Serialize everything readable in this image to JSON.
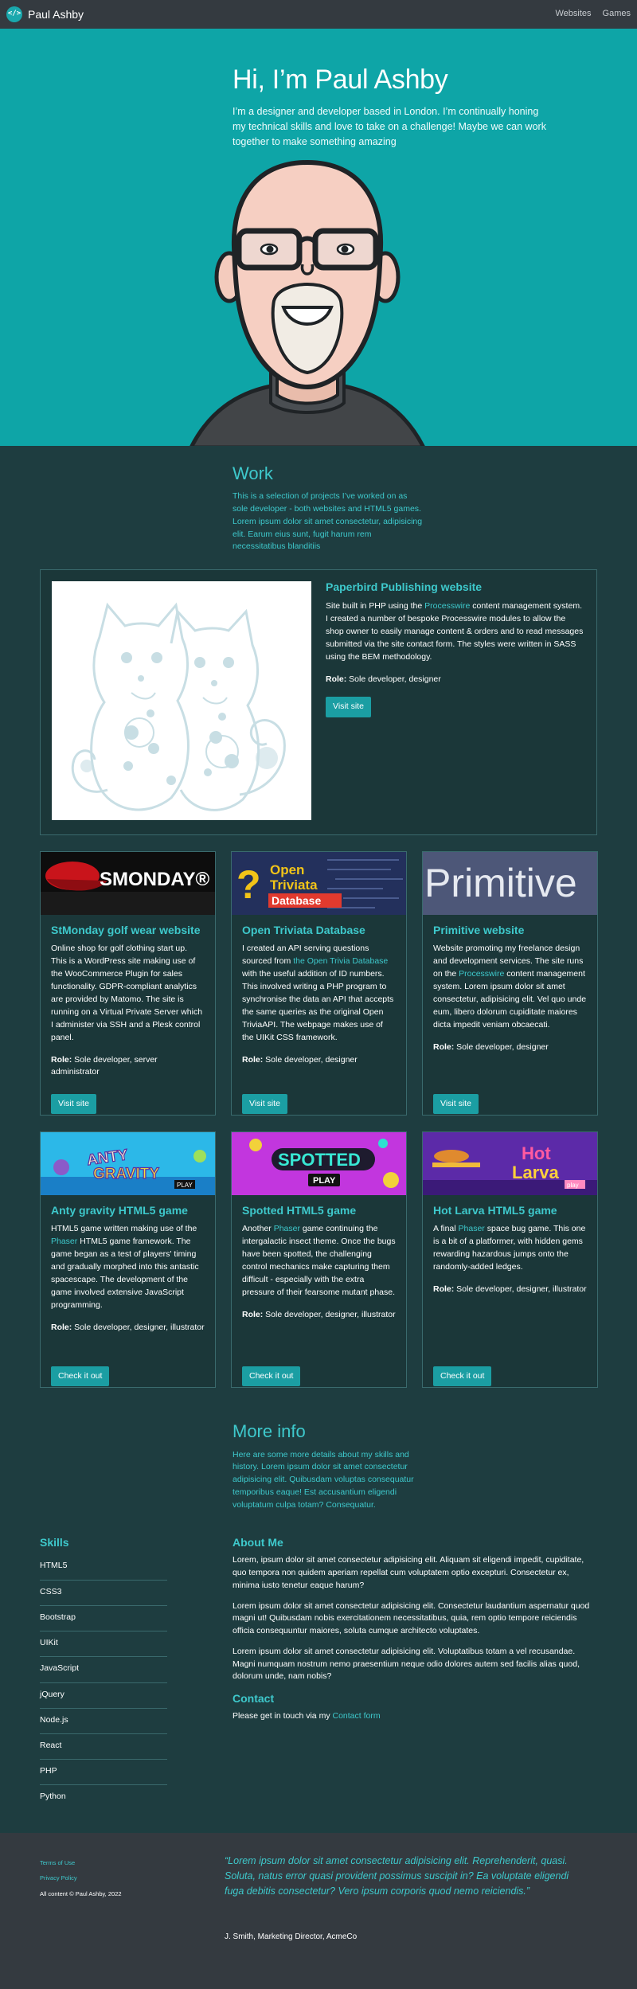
{
  "nav": {
    "brand_icon": "</>",
    "brand_name": "Paul Ashby",
    "links": [
      "Websites",
      "Games"
    ]
  },
  "hero": {
    "title": "Hi, I’m Paul Ashby",
    "subtitle": "I’m a designer and developer based in London. I’m continually honing my technical skills and love to take on a challenge! Maybe we can work together to make something amazing"
  },
  "work": {
    "heading": "Work",
    "intro": "This is a selection of projects I’ve worked on as sole developer - both websites and HTML5 games. Lorem ipsum dolor sit amet consectetur, adipisicing elit. Earum eius sunt, fugit harum rem necessitatibus blanditiis",
    "featured": {
      "title": "Paperbird Publishing website",
      "text_before": "Site built in PHP using the ",
      "link": "Processwire",
      "text_after": " content management system. I created a number of bespoke Processwire modules to allow the shop owner to easily manage content & orders and to read messages submitted via the site contact form. The styles were written in SASS using the BEM methodology.",
      "role_label": "Role:",
      "role": "Sole developer, designer",
      "button": "Visit site"
    },
    "cards": [
      {
        "image_text": "SMONDAY®",
        "title": "StMonday golf wear website",
        "text_before": "Online shop for golf clothing start up. This is a WordPress site making use of the WooCommerce Plugin for sales functionality. GDPR-compliant analytics are provided by Matomo. The site is running on a Virtual Private Server which I administer via SSH and a Plesk control panel.",
        "link": "",
        "text_after": "",
        "role_label": "Role:",
        "role": "Sole developer, server administrator",
        "button": "Visit site"
      },
      {
        "image_text": "Open Triviata Database",
        "title": "Open Triviata Database",
        "text_before": "I created an API serving questions sourced from ",
        "link": "the Open Trivia Database",
        "text_after": " with the useful addition of ID numbers. This involved writing a PHP program to synchronise the data an API that accepts the same queries as the original Open TriviaAPI. The webpage makes use of the UIKit CSS framework.",
        "role_label": "Role:",
        "role": "Sole developer, designer",
        "button": "Visit site"
      },
      {
        "image_text": "Primitive",
        "title": "Primitive website",
        "text_before": "Website promoting my freelance design and development services. The site runs on the ",
        "link": "Processwire",
        "text_after": " content management system. Lorem ipsum dolor sit amet consectetur, adipisicing elit. Vel quo unde eum, libero dolorum cupiditate maiores dicta impedit veniam obcaecati.",
        "role_label": "Role:",
        "role": "Sole developer, designer",
        "button": "Visit site"
      },
      {
        "image_text": "ANTY GRAVITY",
        "title": "Anty gravity HTML5 game",
        "text_before": "HTML5 game written making use of the ",
        "link": "Phaser",
        "text_after": " HTML5 game framework. The game began as a test of players' timing and gradually morphed into this antastic spacescape. The development of the game involved extensive JavaScript programming.",
        "role_label": "Role:",
        "role": "Sole developer, designer, illustrator",
        "button": "Check it out"
      },
      {
        "image_text": "SPOTTED",
        "title": "Spotted HTML5 game",
        "text_before": "Another ",
        "link": "Phaser",
        "text_after": " game continuing the intergalactic insect theme. Once the bugs have been spotted, the challenging control mechanics make capturing them difficult - especially with the extra pressure of their fearsome mutant phase.",
        "role_label": "Role:",
        "role": "Sole developer, designer, illustrator",
        "button": "Check it out"
      },
      {
        "image_text": "Hot Larva",
        "title": "Hot Larva HTML5 game",
        "text_before": "A final ",
        "link": "Phaser",
        "text_after": " space bug game. This one is a bit of a platformer, with hidden gems rewarding hazardous jumps onto the randomly-added ledges.",
        "role_label": "Role:",
        "role": "Sole developer, designer, illustrator",
        "button": "Check it out"
      }
    ]
  },
  "more": {
    "heading": "More info",
    "intro": "Here are some more details about my skills and history. Lorem ipsum dolor sit amet consectetur adipisicing elit. Quibusdam voluptas consequatur temporibus eaque! Est accusantium eligendi voluptatum culpa totam? Consequatur.",
    "skills_heading": "Skills",
    "skills": [
      "HTML5",
      "CSS3",
      "Bootstrap",
      "UIKit",
      "JavaScript",
      "jQuery",
      "Node.js",
      "React",
      "PHP",
      "Python"
    ],
    "about_heading": "About Me",
    "about": [
      "Lorem, ipsum dolor sit amet consectetur adipisicing elit. Aliquam sit eligendi impedit, cupiditate, quo tempora non quidem aperiam repellat cum voluptatem optio excepturi. Consectetur ex, minima iusto tenetur eaque harum?",
      "Lorem ipsum dolor sit amet consectetur adipisicing elit. Consectetur laudantium aspernatur quod magni ut! Quibusdam nobis exercitationem necessitatibus, quia, rem optio tempore reiciendis officia consequuntur maiores, soluta cumque architecto voluptates.",
      "Lorem ipsum dolor sit amet consectetur adipisicing elit. Voluptatibus totam a vel recusandae. Magni numquam nostrum nemo praesentium neque odio dolores autem sed facilis alias quod, dolorum unde, nam nobis?"
    ],
    "contact_heading": "Contact",
    "contact_text": "Please get in touch via my ",
    "contact_link": "Contact form"
  },
  "footer": {
    "link1": "Terms of Use",
    "link2": "Privacy Policy",
    "copyright": "All content © Paul Ashby, 2022",
    "quote": "“Lorem ipsum dolor sit amet consectetur adipisicing elit. Reprehenderit, quasi. Soluta, natus error quasi provident possimus suscipit in? Ea voluptate eligendi fuga debitis consectetur? Vero ipsum corporis quod nemo reiciendis.”",
    "cite": "J. Smith, Marketing Director, AcmeCo"
  },
  "colors": {
    "hero_bg": "#0ea5a7",
    "page_bg": "#1e3d40",
    "accent": "#3ec9cc",
    "button": "#1b9ea3",
    "nav_bg": "#343a40"
  }
}
